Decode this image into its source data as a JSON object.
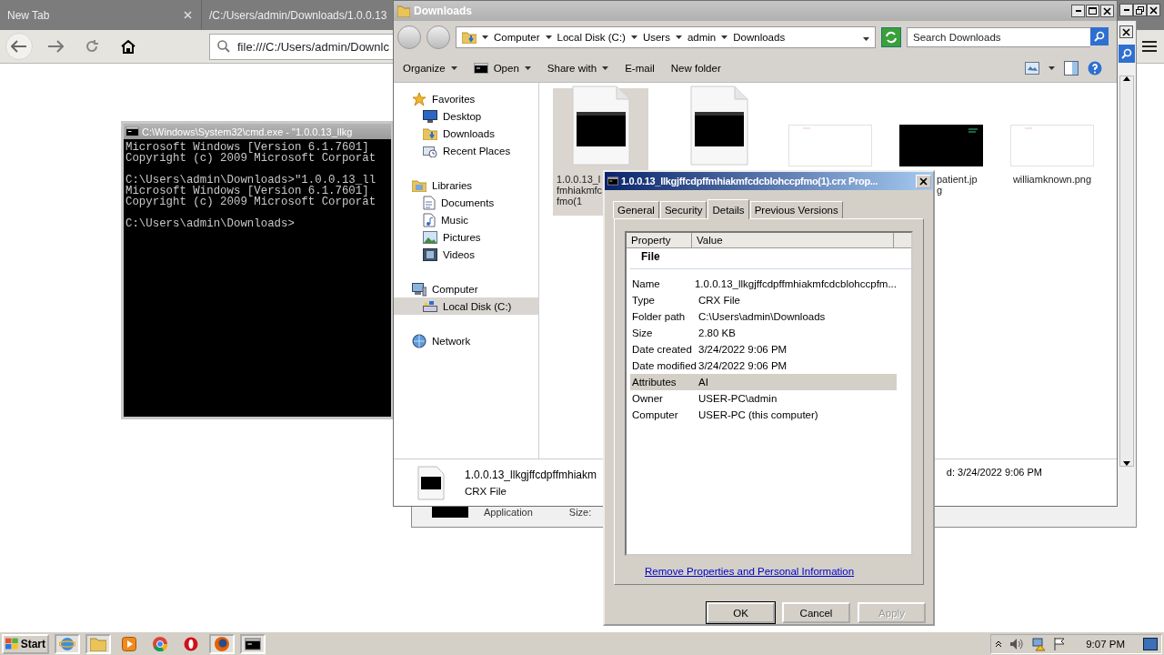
{
  "browser": {
    "tabs": [
      {
        "label": "New Tab"
      },
      {
        "label": "/C:/Users/admin/Downloads/1.0.0.13"
      }
    ],
    "address": "file:///C:/Users/admin/Downlc"
  },
  "back_window": {
    "type_label": "Application",
    "size_label": "Size:"
  },
  "console": {
    "title": "C:\\Windows\\System32\\cmd.exe - \"1.0.0.13_llkg",
    "blocks": [
      [
        "Microsoft Windows [Version 6.1.7601]",
        "Copyright (c) 2009 Microsoft Corporat"
      ],
      [
        "C:\\Users\\admin\\Downloads>\"1.0.0.13_ll",
        "Microsoft Windows [Version 6.1.7601]",
        "Copyright (c) 2009 Microsoft Corporat"
      ],
      [
        "C:\\Users\\admin\\Downloads>"
      ]
    ]
  },
  "explorer": {
    "title": "Downloads",
    "breadcrumb": [
      "Computer",
      "Local Disk (C:)",
      "Users",
      "admin",
      "Downloads"
    ],
    "search": {
      "placeholder": "Search Downloads"
    },
    "toolbar": [
      {
        "label": "Organize",
        "dropdown": true
      },
      {
        "label": "Open",
        "dropdown": true,
        "kind": "console"
      },
      {
        "label": "Share with",
        "dropdown": true
      },
      {
        "label": "E-mail",
        "dropdown": false
      },
      {
        "label": "New folder",
        "dropdown": false
      }
    ],
    "tree": [
      {
        "label": "Favorites",
        "kind": "star",
        "selected": false,
        "children": [
          {
            "label": "Desktop",
            "kind": "desktop",
            "selected": false
          },
          {
            "label": "Downloads",
            "kind": "folder",
            "selected": false
          },
          {
            "label": "Recent Places",
            "kind": "recent",
            "selected": false
          }
        ]
      },
      {
        "label": "Libraries",
        "kind": "library",
        "selected": false,
        "children": [
          {
            "label": "Documents",
            "kind": "document",
            "selected": false
          },
          {
            "label": "Music",
            "kind": "music",
            "selected": false
          },
          {
            "label": "Pictures",
            "kind": "picture",
            "selected": false
          },
          {
            "label": "Videos",
            "kind": "video",
            "selected": false
          }
        ]
      },
      {
        "label": "Computer",
        "kind": "computer",
        "selected": false,
        "children": [
          {
            "label": "Local Disk (C:)",
            "kind": "disk",
            "selected": true
          }
        ]
      },
      {
        "label": "Network",
        "kind": "network",
        "selected": false
      }
    ],
    "files": [
      {
        "kind": "console",
        "selected": true,
        "name_lines": [
          "1.0.0.13_l",
          "fmhiakmfc",
          "fmo(1"
        ]
      },
      {
        "kind": "console",
        "selected": false
      },
      {
        "kind": "image",
        "selected": false
      },
      {
        "kind": "dark-image",
        "selected": false,
        "name_lines": [
          "patient.jp",
          "g"
        ]
      },
      {
        "kind": "image",
        "selected": false,
        "name_lines": [
          "williamknown.png"
        ]
      }
    ],
    "details": {
      "name": "1.0.0.13_llkgjffcdpffmhiakm",
      "type": "CRX File",
      "date": "d: 3/24/2022 9:06 PM"
    }
  },
  "properties": {
    "title": "1.0.0.13_llkgjffcdpffmhiakmfcdcblohccpfmo(1).crx Prop...",
    "tabs": [
      {
        "label": "General",
        "selected": false
      },
      {
        "label": "Security",
        "selected": false
      },
      {
        "label": "Details",
        "selected": true
      },
      {
        "label": "Previous Versions",
        "selected": false
      }
    ],
    "columns": [
      "Property",
      "Value"
    ],
    "section": "File",
    "rows": [
      {
        "property": "Name",
        "value": "1.0.0.13_llkgjffcdpffmhiakmfcdcblohccpfm...",
        "selected": false
      },
      {
        "property": "Type",
        "value": "CRX File",
        "selected": false
      },
      {
        "property": "Folder path",
        "value": "C:\\Users\\admin\\Downloads",
        "selected": false
      },
      {
        "property": "Size",
        "value": "2.80 KB",
        "selected": false
      },
      {
        "property": "Date created",
        "value": "3/24/2022 9:06 PM",
        "selected": false
      },
      {
        "property": "Date modified",
        "value": "3/24/2022 9:06 PM",
        "selected": false
      },
      {
        "property": "Attributes",
        "value": "AI",
        "selected": true
      },
      {
        "property": "Owner",
        "value": "USER-PC\\admin",
        "selected": false
      },
      {
        "property": "Computer",
        "value": "USER-PC (this computer)",
        "selected": false
      }
    ],
    "link": "Remove Properties and Personal Information",
    "buttons": [
      {
        "label": "OK",
        "disabled": false
      },
      {
        "label": "Cancel",
        "disabled": false
      },
      {
        "label": "Apply",
        "disabled": true
      }
    ]
  },
  "taskbar": {
    "start": "Start",
    "items": [
      {
        "kind": "ie",
        "open": true
      },
      {
        "kind": "folder",
        "open": true
      },
      {
        "kind": "media",
        "open": false
      },
      {
        "kind": "chrome",
        "open": false
      },
      {
        "kind": "opera",
        "open": false
      },
      {
        "kind": "firefox",
        "open": true
      },
      {
        "kind": "console",
        "open": true
      }
    ],
    "clock": "9:07 PM"
  }
}
